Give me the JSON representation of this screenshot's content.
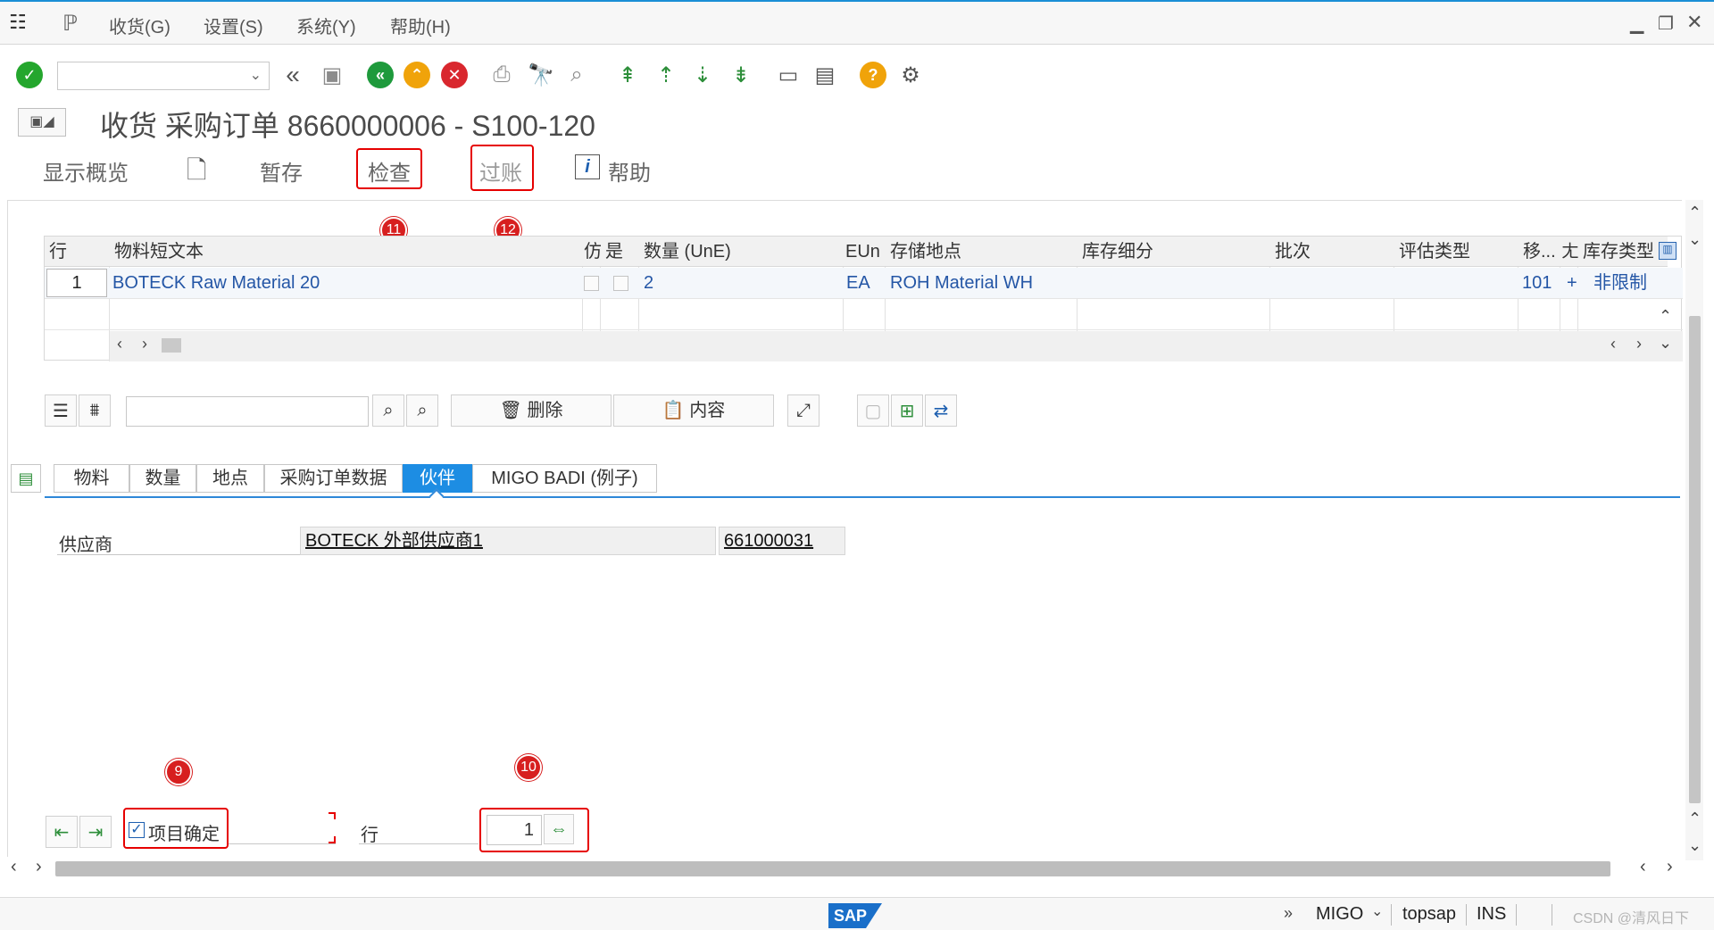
{
  "menubar": {
    "items": [
      "收货(G)",
      "设置(S)",
      "系统(Y)",
      "帮助(H)"
    ]
  },
  "page": {
    "title": "收货 采购订单 8660000006 - S100-120"
  },
  "actions": {
    "overview": "显示概览",
    "hold": "暂存",
    "check": "检查",
    "post": "过账",
    "help": "帮助"
  },
  "badges": [
    "11",
    "12",
    "9",
    "10"
  ],
  "table": {
    "headers": [
      "行",
      "物料短文本",
      "仿",
      "是",
      "数量 (UnE)",
      "EUn",
      "存储地点",
      "库存细分",
      "批次",
      "评估类型",
      "移...",
      "ㄤ",
      "库存类型"
    ],
    "row": {
      "line": "1",
      "material_text": "BOTECK Raw Material 20",
      "qty": "2",
      "unit": "EA",
      "storage": "ROH Material WH",
      "movement": "101",
      "plus": "+",
      "stock_type": "非限制"
    }
  },
  "table_tools": {
    "delete": "删除",
    "contents": "内容"
  },
  "tabs": [
    "物料",
    "数量",
    "地点",
    "采购订单数据",
    "伙伴",
    "MIGO BADI (例子)"
  ],
  "partner": {
    "label": "供应商",
    "vendor_name": "BOTECK 外部供应商1",
    "vendor_id": "661000031"
  },
  "bottom": {
    "item_ok": "项目确定",
    "line_label": "行",
    "line_value": "1"
  },
  "status": {
    "transaction": "MIGO",
    "server": "topsap",
    "mode": "INS",
    "watermark": "CSDN @清风日下"
  },
  "colors": {
    "accent": "#1d8de3",
    "highlight": "#e60000",
    "badge": "#d71f1f"
  }
}
